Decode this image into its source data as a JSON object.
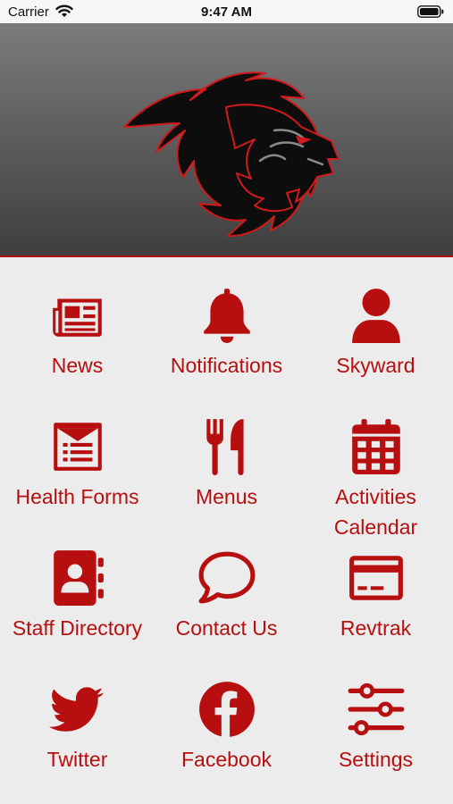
{
  "status_bar": {
    "carrier": "Carrier",
    "time": "9:47 AM"
  },
  "menu": [
    {
      "id": "news",
      "label": "News",
      "icon": "newspaper-icon"
    },
    {
      "id": "notifications",
      "label": "Notifications",
      "icon": "bell-icon"
    },
    {
      "id": "skyward",
      "label": "Skyward",
      "icon": "user-icon"
    },
    {
      "id": "health-forms",
      "label": "Health Forms",
      "icon": "form-icon"
    },
    {
      "id": "menus",
      "label": "Menus",
      "icon": "utensils-icon"
    },
    {
      "id": "activities-calendar",
      "label": "Activities Calendar",
      "label_line1": "Activities",
      "label_line2": "Calendar",
      "icon": "calendar-icon"
    },
    {
      "id": "staff-directory",
      "label": "Staff Directory",
      "icon": "address-book-icon"
    },
    {
      "id": "contact-us",
      "label": "Contact Us",
      "icon": "chat-icon"
    },
    {
      "id": "revtrak",
      "label": "Revtrak",
      "icon": "credit-card-icon"
    },
    {
      "id": "twitter",
      "label": "Twitter",
      "icon": "twitter-icon"
    },
    {
      "id": "facebook",
      "label": "Facebook",
      "icon": "facebook-icon"
    },
    {
      "id": "settings",
      "label": "Settings",
      "icon": "sliders-icon"
    }
  ],
  "colors": {
    "accent": "#b70f0f",
    "background": "#ececec",
    "header_top": "#7b7b7b",
    "header_bottom": "#3e3e3e"
  }
}
